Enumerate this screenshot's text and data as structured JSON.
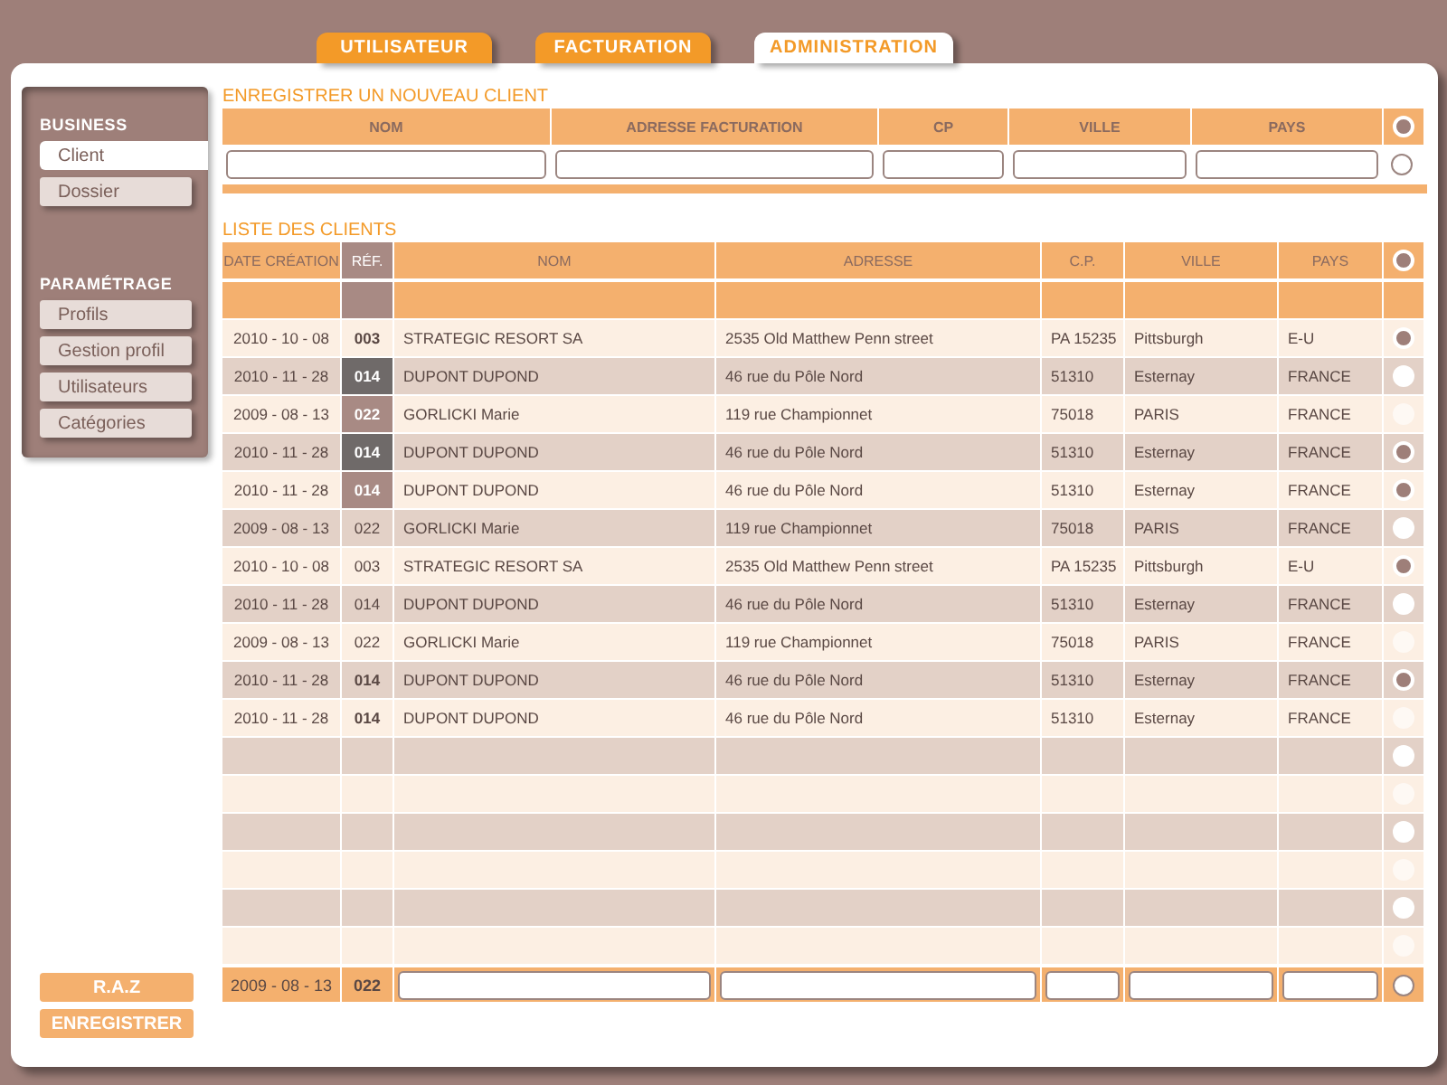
{
  "tabs": [
    {
      "label": "UTILISATEUR",
      "selected": false
    },
    {
      "label": "FACTURATION",
      "selected": false
    },
    {
      "label": "ADMINISTRATION",
      "selected": true
    }
  ],
  "sidebar": {
    "sections": [
      {
        "title": "BUSINESS",
        "items": [
          {
            "label": "Client",
            "selected": true
          },
          {
            "label": "Dossier",
            "selected": false
          }
        ]
      },
      {
        "title": "PARAMÉTRAGE",
        "items": [
          {
            "label": "Profils",
            "selected": false
          },
          {
            "label": "Gestion profil",
            "selected": false
          },
          {
            "label": "Utilisateurs",
            "selected": false
          },
          {
            "label": "Catégories",
            "selected": false
          }
        ]
      }
    ]
  },
  "buttons": [
    "R.A.Z",
    "ENREGISTRER"
  ],
  "new_client": {
    "title": "ENREGISTRER UN NOUVEAU CLIENT",
    "selected": false,
    "columns": [
      "NOM",
      "ADRESSE FACTURATION",
      "CP",
      "VILLE",
      "PAYS"
    ]
  },
  "client_list": {
    "title": "LISTE DES CLIENTS",
    "columns": [
      "DATE CRÉATION",
      "RÉF.",
      "NOM",
      "ADRESSE",
      "C.P.",
      "VILLE",
      "PAYS"
    ],
    "rows": [
      {
        "kind": "bold",
        "date": "2010 - 10 - 08",
        "ref": "003",
        "name": "STRATEGIC RESORT SA",
        "address": "2535 Old Matthew Penn street",
        "cp": "PA 15235",
        "city": "Pittsburgh",
        "country": "E-U",
        "selected": true
      },
      {
        "kind": "dark",
        "date": "2010 - 11 - 28",
        "ref": "014",
        "name": "DUPONT DUPOND",
        "address": "46 rue du Pôle Nord",
        "cp": "51310",
        "city": "Esternay",
        "country": "FRANCE",
        "selected": false
      },
      {
        "kind": "muted",
        "date": "2009 - 08 - 13",
        "ref": "022",
        "name": "GORLICKI Marie",
        "address": "119 rue Championnet",
        "cp": "75018",
        "city": "PARIS",
        "country": "FRANCE",
        "selected": false
      },
      {
        "kind": "dark",
        "date": "2010 - 11 - 28",
        "ref": "014",
        "name": "DUPONT DUPOND",
        "address": "46 rue du Pôle Nord",
        "cp": "51310",
        "city": "Esternay",
        "country": "FRANCE",
        "selected": true
      },
      {
        "kind": "muted",
        "date": "2010 - 11 - 28",
        "ref": "014",
        "name": "DUPONT DUPOND",
        "address": "46 rue du Pôle Nord",
        "cp": "51310",
        "city": "Esternay",
        "country": "FRANCE",
        "selected": true
      },
      {
        "kind": "plain",
        "date": "2009 - 08 - 13",
        "ref": "022",
        "name": "GORLICKI Marie",
        "address": "119 rue Championnet",
        "cp": "75018",
        "city": "PARIS",
        "country": "FRANCE",
        "selected": false
      },
      {
        "kind": "plain",
        "date": "2010 - 10 - 08",
        "ref": "003",
        "name": "STRATEGIC RESORT SA",
        "address": "2535 Old Matthew Penn street",
        "cp": "PA 15235",
        "city": "Pittsburgh",
        "country": "E-U",
        "selected": true
      },
      {
        "kind": "plain",
        "date": "2010 - 11 - 28",
        "ref": "014",
        "name": "DUPONT DUPOND",
        "address": "46 rue du Pôle Nord",
        "cp": "51310",
        "city": "Esternay",
        "country": "FRANCE",
        "selected": false
      },
      {
        "kind": "plain",
        "date": "2009 - 08 - 13",
        "ref": "022",
        "name": "GORLICKI Marie",
        "address": "119 rue Championnet",
        "cp": "75018",
        "city": "PARIS",
        "country": "FRANCE",
        "selected": false
      },
      {
        "kind": "bold",
        "date": "2010 - 11 - 28",
        "ref": "014",
        "name": "DUPONT DUPOND",
        "address": "46 rue du Pôle Nord",
        "cp": "51310",
        "city": "Esternay",
        "country": "FRANCE",
        "selected": true
      },
      {
        "kind": "bold",
        "date": "2010 - 11 - 28",
        "ref": "014",
        "name": "DUPONT DUPOND",
        "address": "46 rue du Pôle Nord",
        "cp": "51310",
        "city": "Esternay",
        "country": "FRANCE",
        "selected": false
      }
    ],
    "empty_rows": [
      {
        "selected": false
      },
      {
        "selected": false
      },
      {
        "selected": false
      },
      {
        "selected": false
      },
      {
        "selected": false
      },
      {
        "selected": false
      }
    ],
    "entry_row": {
      "date": "2009 - 08 - 13",
      "ref": "022",
      "selected": false
    }
  }
}
